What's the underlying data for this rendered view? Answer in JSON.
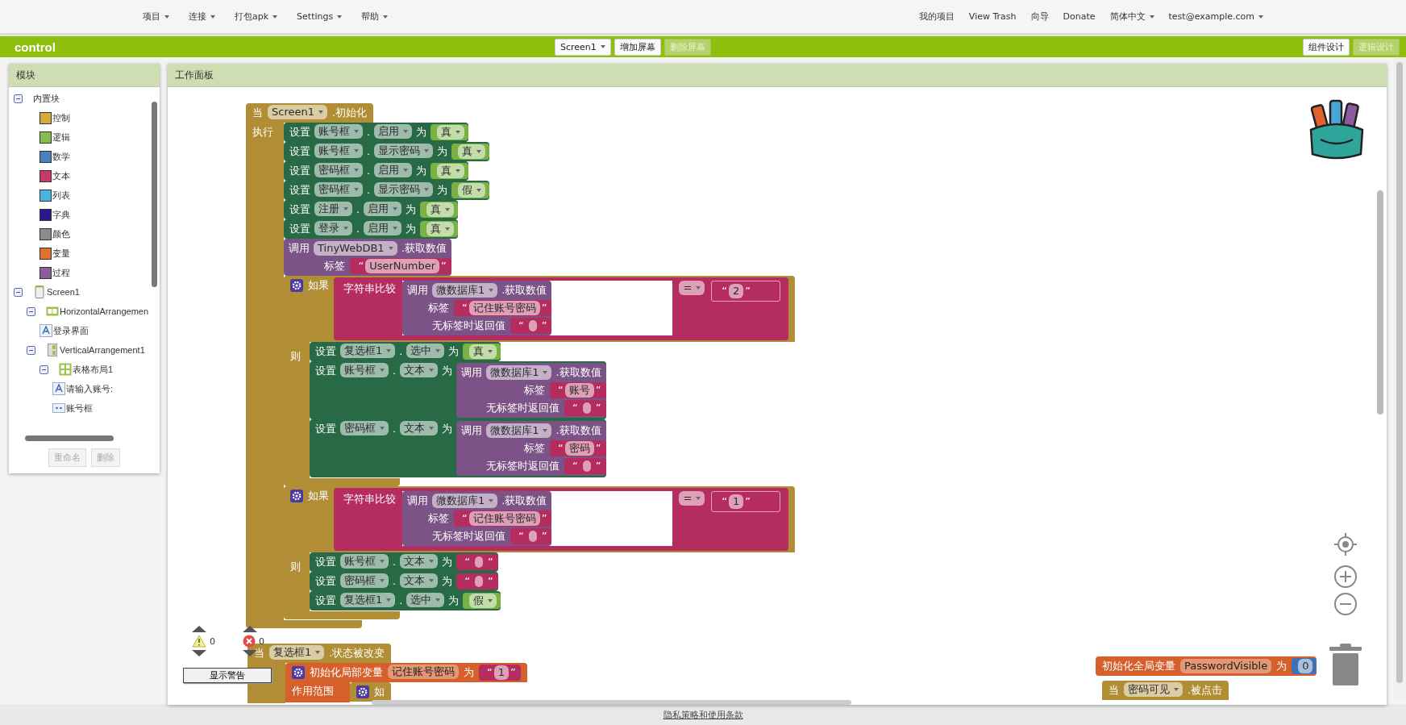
{
  "menu": {
    "left": [
      {
        "label": "项目",
        "dropdown": true
      },
      {
        "label": "连接",
        "dropdown": true
      },
      {
        "label": "打包apk",
        "dropdown": true
      },
      {
        "label": "Settings",
        "dropdown": true
      },
      {
        "label": "帮助",
        "dropdown": true
      }
    ],
    "right": [
      {
        "label": "我的项目",
        "dropdown": false
      },
      {
        "label": "View Trash",
        "dropdown": false
      },
      {
        "label": "向导",
        "dropdown": false
      },
      {
        "label": "Donate",
        "dropdown": false
      },
      {
        "label": "简体中文",
        "dropdown": true
      },
      {
        "label": "test@example.com",
        "dropdown": true
      }
    ]
  },
  "project_bar": {
    "title": "control",
    "screen": "Screen1",
    "buttons": [
      {
        "label": "增加屏幕",
        "disabled": false
      },
      {
        "label": "删除屏幕",
        "disabled": true
      }
    ],
    "views": [
      {
        "label": "组件设计",
        "selected": false
      },
      {
        "label": "逻辑设计",
        "selected": true
      }
    ]
  },
  "blocks_panel": {
    "title": "模块",
    "tree": [
      {
        "label": "内置块",
        "kind": "group",
        "expanded": true,
        "children": [
          {
            "label": "控制",
            "kind": "category",
            "color": "#d6a93c"
          },
          {
            "label": "逻辑",
            "kind": "category",
            "color": "#86bd4c"
          },
          {
            "label": "数学",
            "kind": "category",
            "color": "#4a7fc0"
          },
          {
            "label": "文本",
            "kind": "category",
            "color": "#c83a6a"
          },
          {
            "label": "列表",
            "kind": "category",
            "color": "#4ab3e0"
          },
          {
            "label": "字典",
            "kind": "category",
            "color": "#2b1890"
          },
          {
            "label": "颜色",
            "kind": "category",
            "color": "#8c8c8c"
          },
          {
            "label": "变量",
            "kind": "category",
            "color": "#e2702f"
          },
          {
            "label": "过程",
            "kind": "category",
            "color": "#8e5c9c"
          }
        ]
      },
      {
        "label": "Screen1",
        "kind": "screen",
        "expanded": true,
        "children": [
          {
            "label": "HorizontalArrangemen",
            "kind": "horizontal",
            "expanded": true,
            "children": [
              {
                "label": "登录界面",
                "kind": "label"
              }
            ]
          },
          {
            "label": "VerticalArrangement1",
            "kind": "vertical",
            "expanded": true,
            "children": [
              {
                "label": "表格布局1",
                "kind": "table",
                "expanded": true,
                "children": [
                  {
                    "label": "请输入账号:",
                    "kind": "label"
                  },
                  {
                    "label": "账号框",
                    "kind": "textbox"
                  }
                ]
              }
            ]
          }
        ]
      }
    ],
    "buttons": [
      {
        "label": "重命名",
        "disabled": true
      },
      {
        "label": "删除",
        "disabled": true
      }
    ]
  },
  "workspace": {
    "title": "工作面板",
    "blocks": [
      {
        "kind": "event",
        "keyword": "当",
        "component": "Screen1",
        "event": ".初始化",
        "body_label": "执行",
        "body": [
          {
            "kind": "set",
            "keyword": "设置",
            "component": "账号框",
            "dot": ".",
            "property": "启用",
            "to": "为",
            "value": {
              "kind": "bool",
              "text": "真"
            }
          },
          {
            "kind": "set",
            "keyword": "设置",
            "component": "账号框",
            "dot": ".",
            "property": "显示密码",
            "to": "为",
            "value": {
              "kind": "bool",
              "text": "真"
            }
          },
          {
            "kind": "set",
            "keyword": "设置",
            "component": "密码框",
            "dot": ".",
            "property": "启用",
            "to": "为",
            "value": {
              "kind": "bool",
              "text": "真"
            }
          },
          {
            "kind": "set",
            "keyword": "设置",
            "component": "密码框",
            "dot": ".",
            "property": "显示密码",
            "to": "为",
            "value": {
              "kind": "bool",
              "text": "假"
            }
          },
          {
            "kind": "set",
            "keyword": "设置",
            "component": "注册",
            "dot": ".",
            "property": "启用",
            "to": "为",
            "value": {
              "kind": "bool",
              "text": "真"
            }
          },
          {
            "kind": "set",
            "keyword": "设置",
            "component": "登录",
            "dot": ".",
            "property": "启用",
            "to": "为",
            "value": {
              "kind": "bool",
              "text": "真"
            }
          },
          {
            "kind": "call",
            "keyword": "调用",
            "component": "TinyWebDB1",
            "method": ".获取数值",
            "args": [
              {
                "label": "标签",
                "value": {
                  "kind": "text",
                  "open": "“",
                  "text": "UserNumber",
                  "close": "”"
                }
              }
            ]
          },
          {
            "kind": "if",
            "keyword": "如果",
            "condition": {
              "kind": "compare",
              "label": "字符串比较",
              "left": {
                "kind": "call",
                "keyword": "调用",
                "component": "微数据库1",
                "method": ".获取数值",
                "args": [
                  {
                    "label": "标签",
                    "value": {
                      "kind": "text",
                      "open": "“",
                      "text": "记住账号密码",
                      "close": "”"
                    }
                  },
                  {
                    "label": "无标签时返回值",
                    "value": {
                      "kind": "text",
                      "open": "“",
                      "close": "”"
                    }
                  }
                ]
              },
              "op": "=",
              "right": {
                "kind": "text",
                "open": "“",
                "text": "2",
                "close": "”"
              }
            },
            "then_label": "则",
            "then": [
              {
                "kind": "set",
                "keyword": "设置",
                "component": "复选框1",
                "dot": ".",
                "property": "选中",
                "to": "为",
                "value": {
                  "kind": "bool",
                  "text": "真"
                }
              },
              {
                "kind": "set",
                "keyword": "设置",
                "component": "账号框",
                "dot": ".",
                "property": "文本",
                "to": "为",
                "value": {
                  "kind": "call",
                  "keyword": "调用",
                  "component": "微数据库1",
                  "method": ".获取数值",
                  "args": [
                    {
                      "label": "标签",
                      "value": {
                        "kind": "text",
                        "open": "“",
                        "text": "账号",
                        "close": "”"
                      }
                    },
                    {
                      "label": "无标签时返回值",
                      "value": {
                        "kind": "text",
                        "open": "“",
                        "close": "”"
                      }
                    }
                  ]
                }
              },
              {
                "kind": "set",
                "keyword": "设置",
                "component": "密码框",
                "dot": ".",
                "property": "文本",
                "to": "为",
                "value": {
                  "kind": "call",
                  "keyword": "调用",
                  "component": "微数据库1",
                  "method": ".获取数值",
                  "args": [
                    {
                      "label": "标签",
                      "value": {
                        "kind": "text",
                        "open": "“",
                        "text": "密码",
                        "close": "”"
                      }
                    },
                    {
                      "label": "无标签时返回值",
                      "value": {
                        "kind": "text",
                        "open": "“",
                        "close": "”"
                      }
                    }
                  ]
                }
              }
            ]
          },
          {
            "kind": "if",
            "keyword": "如果",
            "condition": {
              "kind": "compare",
              "label": "字符串比较",
              "left": {
                "kind": "call",
                "keyword": "调用",
                "component": "微数据库1",
                "method": ".获取数值",
                "args": [
                  {
                    "label": "标签",
                    "value": {
                      "kind": "text",
                      "open": "“",
                      "text": "记住账号密码",
                      "close": "”"
                    }
                  },
                  {
                    "label": "无标签时返回值",
                    "value": {
                      "kind": "text",
                      "open": "“",
                      "close": "”"
                    }
                  }
                ]
              },
              "op": "=",
              "right": {
                "kind": "text",
                "open": "“",
                "text": "1",
                "close": "”"
              }
            },
            "then_label": "则",
            "then": [
              {
                "kind": "set",
                "keyword": "设置",
                "component": "账号框",
                "dot": ".",
                "property": "文本",
                "to": "为",
                "value": {
                  "kind": "text",
                  "open": "“",
                  "close": "”"
                }
              },
              {
                "kind": "set",
                "keyword": "设置",
                "component": "密码框",
                "dot": ".",
                "property": "文本",
                "to": "为",
                "value": {
                  "kind": "text",
                  "open": "“",
                  "close": "”"
                }
              },
              {
                "kind": "set",
                "keyword": "设置",
                "component": "复选框1",
                "dot": ".",
                "property": "选中",
                "to": "为",
                "value": {
                  "kind": "bool",
                  "text": "假"
                }
              }
            ]
          }
        ]
      },
      {
        "kind": "event",
        "keyword": "当",
        "component": "复选框1",
        "event": ".状态被改变",
        "body": [
          {
            "kind": "local",
            "keyword": "初始化局部变量",
            "name": "记住账号密码",
            "to": "为",
            "value": {
              "kind": "text",
              "open": "“",
              "text": "1",
              "close": "”"
            },
            "scope_label": "作用范围",
            "body": [
              {
                "kind": "if",
                "keyword": "如"
              }
            ]
          }
        ]
      },
      {
        "kind": "global",
        "keyword": "初始化全局变量",
        "name": "PasswordVisible",
        "to": "为",
        "value": {
          "kind": "number",
          "text": "0"
        }
      },
      {
        "kind": "event",
        "keyword": "当",
        "component": "密码可见",
        "event": ".被点击"
      }
    ],
    "warnings": {
      "warning_count": "0",
      "error_count": "0",
      "toggle": "显示警告"
    }
  },
  "footer": {
    "link": "隐私策略和使用条款"
  }
}
